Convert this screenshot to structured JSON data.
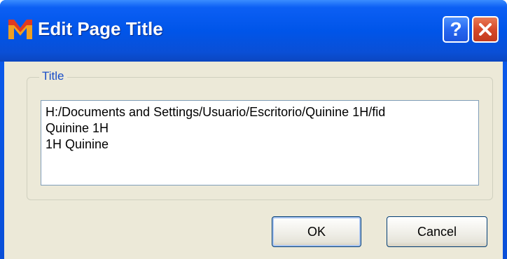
{
  "window": {
    "title": "Edit Page Title",
    "help_label": "?"
  },
  "group": {
    "label": "Title"
  },
  "textarea": {
    "lines": [
      "H:/Documents and Settings/Usuario/Escritorio/Quinine 1H/fid",
      "Quinine 1H",
      "1H Quinine"
    ]
  },
  "buttons": {
    "ok_label": "OK",
    "cancel_label": "Cancel"
  },
  "colors": {
    "titlebar": "#0055e9",
    "close_button": "#d6492a",
    "client_bg": "#ece9d8",
    "group_label": "#1a4ec8"
  }
}
